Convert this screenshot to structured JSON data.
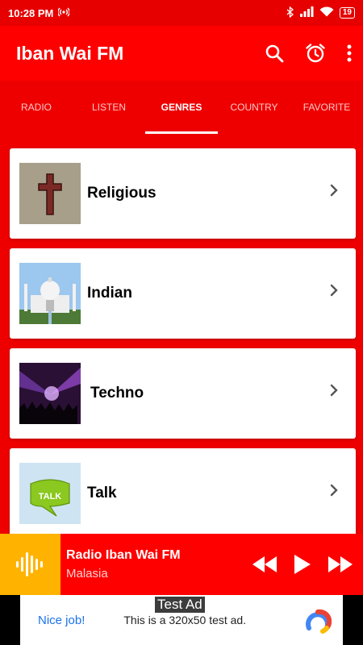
{
  "status": {
    "time": "10:28 PM",
    "battery": "19"
  },
  "appbar": {
    "title": "Iban Wai FM"
  },
  "tabs": [
    {
      "label": "RADIO"
    },
    {
      "label": "LISTEN"
    },
    {
      "label": "GENRES",
      "active": true
    },
    {
      "label": "COUNTRY"
    },
    {
      "label": "FAVORITE"
    }
  ],
  "genres": [
    {
      "label": "Religious",
      "icon": "cross-image"
    },
    {
      "label": "Indian",
      "icon": "taj-mahal-image"
    },
    {
      "label": "Techno",
      "icon": "concert-image"
    },
    {
      "label": "Talk",
      "icon": "talk-bubble-image"
    }
  ],
  "player": {
    "station": "Radio Iban Wai FM",
    "country": "Malasia"
  },
  "ad": {
    "badge": "Test Ad",
    "nice": "Nice job!",
    "message": "This is a 320x50 test ad."
  },
  "colors": {
    "primary": "#ff0000",
    "accent": "#ffb300",
    "link": "#1a73e8"
  }
}
